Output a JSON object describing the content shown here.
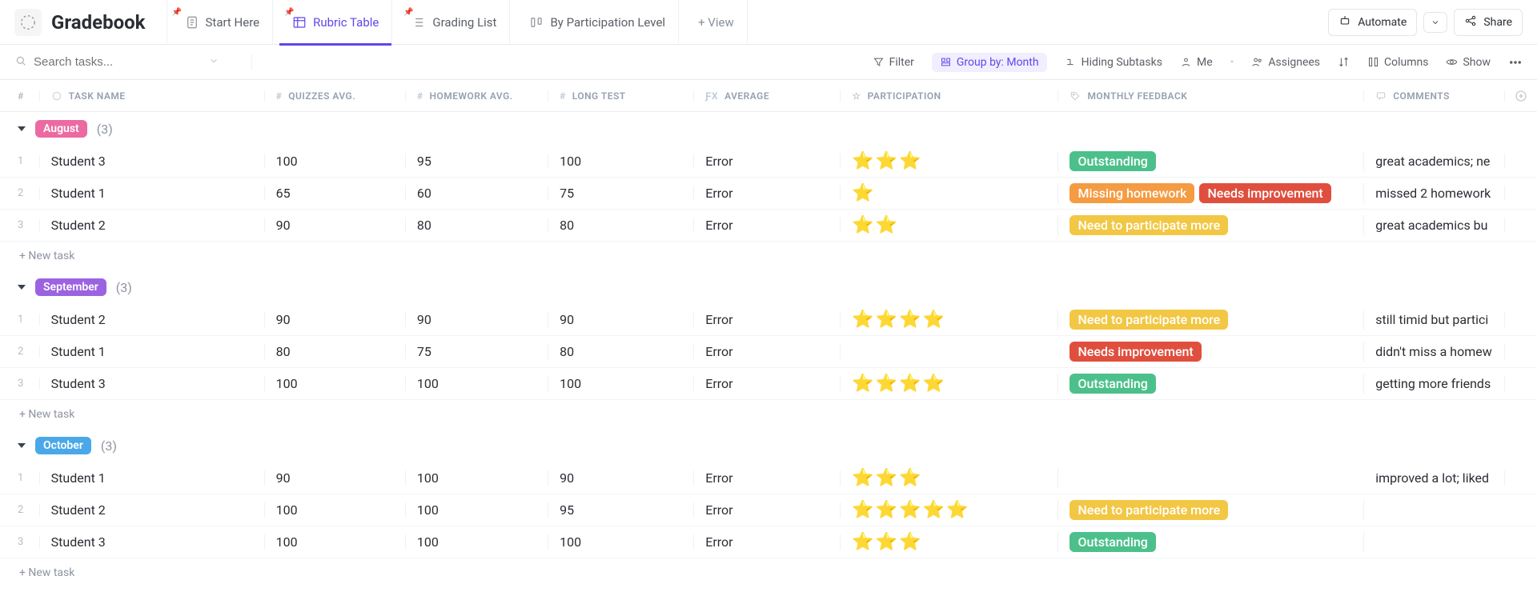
{
  "header": {
    "title": "Gradebook",
    "tabs": [
      {
        "label": "Start Here",
        "icon": "doc"
      },
      {
        "label": "Rubric Table",
        "icon": "table",
        "active": true
      },
      {
        "label": "Grading List",
        "icon": "list"
      },
      {
        "label": "By Participation Level",
        "icon": "board"
      }
    ],
    "add_view": "+  View",
    "automate": "Automate",
    "share": "Share"
  },
  "toolbar": {
    "search_placeholder": "Search tasks...",
    "filter": "Filter",
    "group_by": "Group by: Month",
    "hiding_subtasks": "Hiding Subtasks",
    "me": "Me",
    "assignees": "Assignees",
    "columns": "Columns",
    "show": "Show"
  },
  "columns": {
    "num": "#",
    "name": "TASK NAME",
    "quizzes": "QUIZZES AVG.",
    "homework": "HOMEWORK AVG.",
    "longtest": "LONG TEST",
    "average": "AVERAGE",
    "participation": "PARTICIPATION",
    "feedback": "MONTHLY FEEDBACK",
    "comments": "COMMENTS"
  },
  "tags": {
    "outstanding": {
      "label": "Outstanding",
      "color": "#4cc08b"
    },
    "missing_hw": {
      "label": "Missing homework",
      "color": "#f59b42"
    },
    "needs_improvement": {
      "label": "Needs improvement",
      "color": "#e04f3e"
    },
    "participate_more": {
      "label": "Need to participate more",
      "color": "#f2c744"
    }
  },
  "groups": [
    {
      "name": "August",
      "color": "#ec6aa1",
      "count": "(3)",
      "rows": [
        {
          "n": "1",
          "name": "Student 3",
          "q": "100",
          "h": "95",
          "l": "100",
          "a": "Error",
          "stars": 3,
          "tags": [
            "outstanding"
          ],
          "c": "great academics; ne"
        },
        {
          "n": "2",
          "name": "Student 1",
          "q": "65",
          "h": "60",
          "l": "75",
          "a": "Error",
          "stars": 1,
          "tags": [
            "missing_hw",
            "needs_improvement"
          ],
          "c": "missed 2 homework"
        },
        {
          "n": "3",
          "name": "Student 2",
          "q": "90",
          "h": "80",
          "l": "80",
          "a": "Error",
          "stars": 2,
          "tags": [
            "participate_more"
          ],
          "c": "great academics bu"
        }
      ]
    },
    {
      "name": "September",
      "color": "#9b63e0",
      "count": "(3)",
      "rows": [
        {
          "n": "1",
          "name": "Student 2",
          "q": "90",
          "h": "90",
          "l": "90",
          "a": "Error",
          "stars": 4,
          "tags": [
            "participate_more"
          ],
          "c": "still timid but partici"
        },
        {
          "n": "2",
          "name": "Student 1",
          "q": "80",
          "h": "75",
          "l": "80",
          "a": "Error",
          "stars": 0,
          "tags": [
            "needs_improvement"
          ],
          "c": "didn't miss a homew"
        },
        {
          "n": "3",
          "name": "Student 3",
          "q": "100",
          "h": "100",
          "l": "100",
          "a": "Error",
          "stars": 4,
          "tags": [
            "outstanding"
          ],
          "c": "getting more friends"
        }
      ]
    },
    {
      "name": "October",
      "color": "#4aa8e8",
      "count": "(3)",
      "rows": [
        {
          "n": "1",
          "name": "Student 1",
          "q": "90",
          "h": "100",
          "l": "90",
          "a": "Error",
          "stars": 3,
          "tags": [],
          "c": "improved a lot; liked"
        },
        {
          "n": "2",
          "name": "Student 2",
          "q": "100",
          "h": "100",
          "l": "95",
          "a": "Error",
          "stars": 5,
          "tags": [
            "participate_more"
          ],
          "c": ""
        },
        {
          "n": "3",
          "name": "Student 3",
          "q": "100",
          "h": "100",
          "l": "100",
          "a": "Error",
          "stars": 3,
          "tags": [
            "outstanding"
          ],
          "c": ""
        }
      ]
    }
  ],
  "new_task": "+ New task"
}
